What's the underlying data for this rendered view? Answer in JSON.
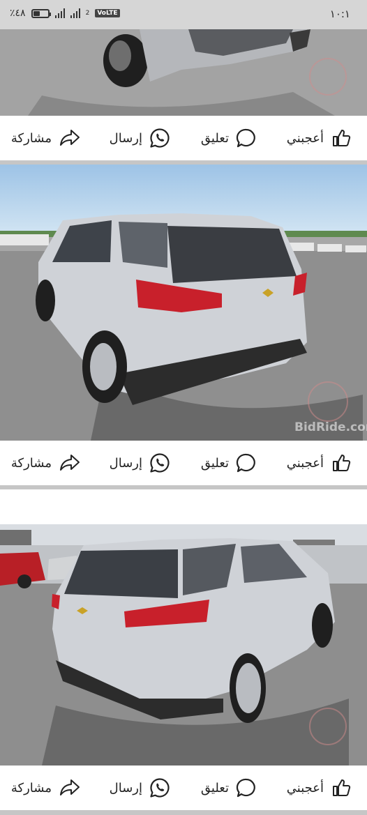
{
  "status_bar": {
    "time": "١٠:١",
    "battery_text": "٪٤٨",
    "battery_level": 0.48,
    "network_label": "VoLTE",
    "sim_label": "2"
  },
  "posts": [
    {
      "actions": {
        "like": {
          "label": "أعجبني",
          "icon": "thumbs-up-icon"
        },
        "comment": {
          "label": "تعليق",
          "icon": "speech-bubble-icon"
        },
        "send": {
          "label": "إرسال",
          "icon": "whatsapp-icon"
        },
        "share": {
          "label": "مشاركة",
          "icon": "share-arrow-icon"
        }
      }
    },
    {
      "photo_watermark": "BidRide.com",
      "actions": {
        "like": {
          "label": "أعجبني",
          "icon": "thumbs-up-icon"
        },
        "comment": {
          "label": "تعليق",
          "icon": "speech-bubble-icon"
        },
        "send": {
          "label": "إرسال",
          "icon": "whatsapp-icon"
        },
        "share": {
          "label": "مشاركة",
          "icon": "share-arrow-icon"
        }
      }
    },
    {
      "actions": {
        "like": {
          "label": "أعجبني",
          "icon": "thumbs-up-icon"
        },
        "comment": {
          "label": "تعليق",
          "icon": "speech-bubble-icon"
        },
        "send": {
          "label": "إرسال",
          "icon": "whatsapp-icon"
        },
        "share": {
          "label": "مشاركة",
          "icon": "share-arrow-icon"
        }
      }
    }
  ],
  "colors": {
    "car_body": "#c9cdd3",
    "tail_light": "#c8202b",
    "asphalt": "#8d8d8d",
    "sky": "#b9d7ef"
  }
}
